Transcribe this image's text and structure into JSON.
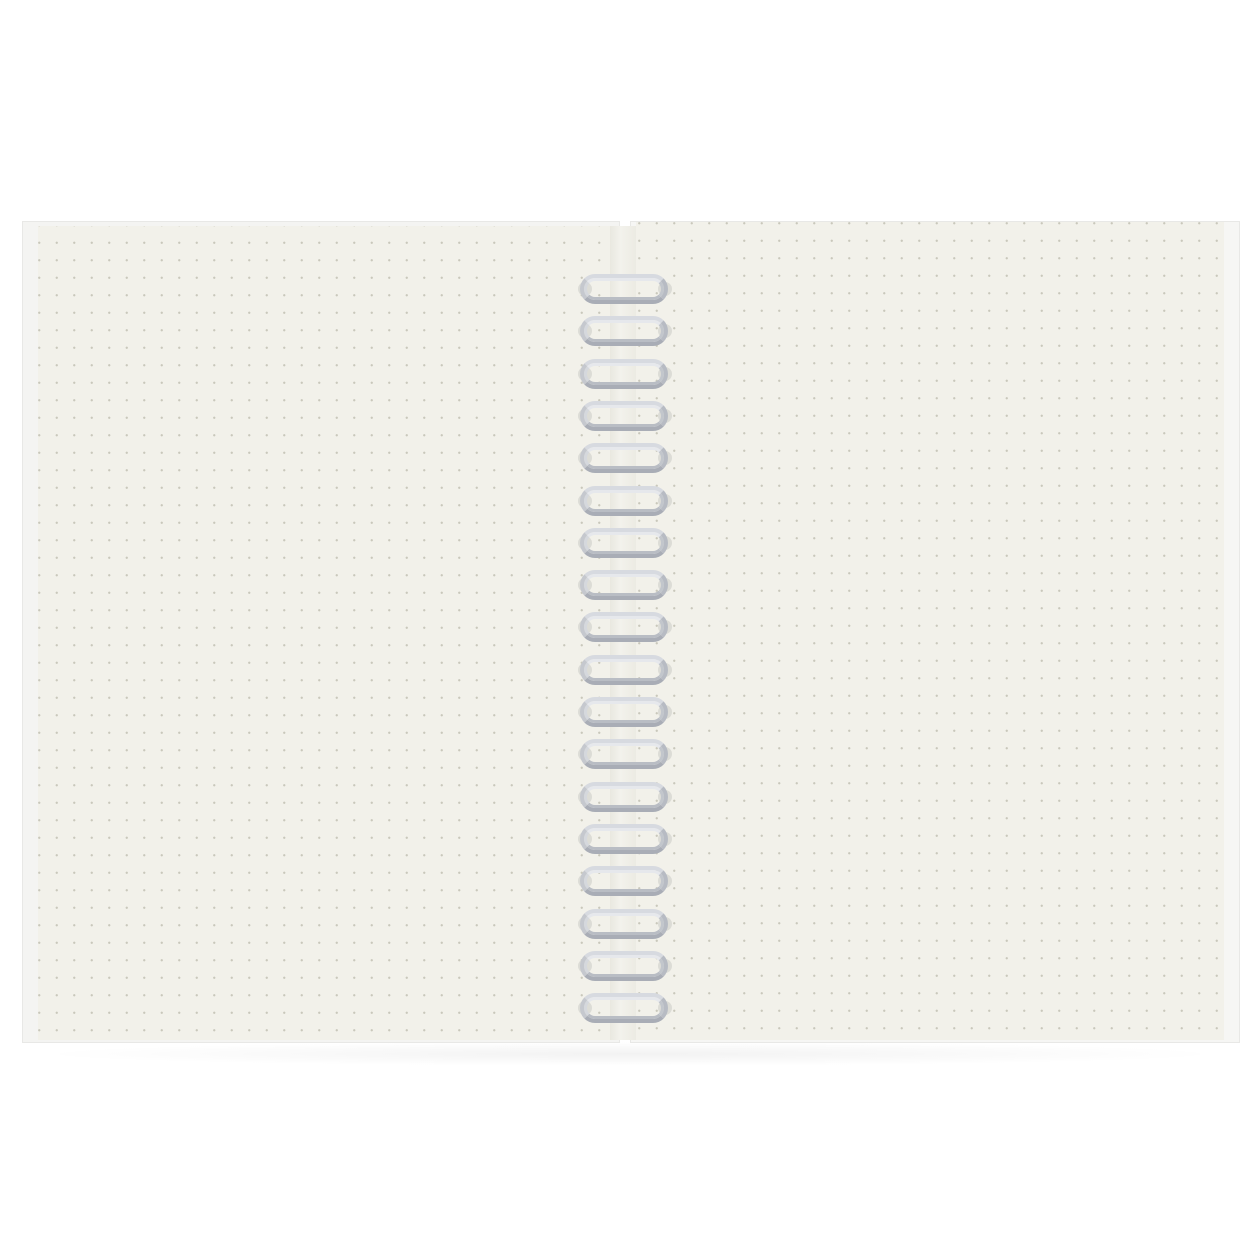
{
  "scene": {
    "subject": "open-spiral-notebook",
    "page_style": "dot-grid",
    "spiral_rings": 18,
    "colors": {
      "background": "#ffffff",
      "paper": "#f2f1ea",
      "dots": "#c9c8bb",
      "cover": "#f4f4f2",
      "wire": "#c9ccd2"
    }
  }
}
